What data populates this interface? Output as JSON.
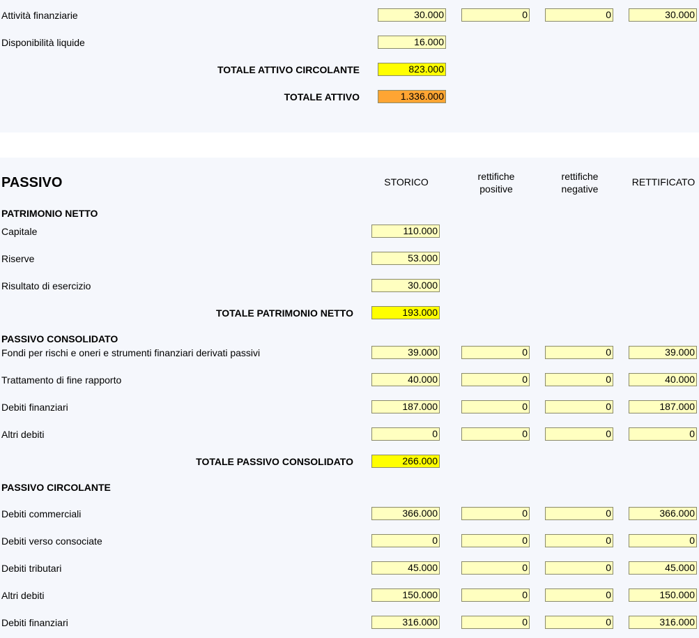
{
  "attivo_tail": {
    "rows": [
      {
        "label": "Attività finanziarie",
        "values": [
          "30.000",
          "0",
          "0",
          "30.000"
        ]
      },
      {
        "label": "Disponibilità liquide",
        "values": [
          "16.000"
        ]
      }
    ],
    "total_circolante": {
      "label": "TOTALE ATTIVO CIRCOLANTE",
      "value": "823.000"
    },
    "total_attivo": {
      "label": "TOTALE ATTIVO",
      "value": "1.336.000"
    }
  },
  "passivo": {
    "title": "PASSIVO",
    "columns": [
      "STORICO",
      "rettifiche\npositive",
      "rettifiche\nnegative",
      "RETTIFICATO"
    ],
    "patrimonio": {
      "heading": "PATRIMONIO NETTO",
      "rows": [
        {
          "label": "Capitale",
          "value": "110.000"
        },
        {
          "label": "Riserve",
          "value": "53.000"
        },
        {
          "label": "Risultato di esercizio",
          "value": "30.000"
        }
      ],
      "total": {
        "label": "TOTALE PATRIMONIO NETTO",
        "value": "193.000"
      }
    },
    "consolidato": {
      "heading": "PASSIVO CONSOLIDATO",
      "rows": [
        {
          "label": "Fondi per rischi e oneri e strumenti finanziari derivati passivi",
          "values": [
            "39.000",
            "0",
            "0",
            "39.000"
          ]
        },
        {
          "label": "Trattamento di fine rapporto",
          "values": [
            "40.000",
            "0",
            "0",
            "40.000"
          ]
        },
        {
          "label": "Debiti finanziari",
          "values": [
            "187.000",
            "0",
            "0",
            "187.000"
          ]
        },
        {
          "label": "Altri debiti",
          "values": [
            "0",
            "0",
            "0",
            "0"
          ]
        }
      ],
      "total": {
        "label": "TOTALE PASSIVO CONSOLIDATO",
        "value": "266.000"
      }
    },
    "circolante": {
      "heading": "PASSIVO CIRCOLANTE",
      "rows": [
        {
          "label": "Debiti commerciali",
          "values": [
            "366.000",
            "0",
            "0",
            "366.000"
          ]
        },
        {
          "label": "Debiti verso consociate",
          "values": [
            "0",
            "0",
            "0",
            "0"
          ]
        },
        {
          "label": "Debiti tributari",
          "values": [
            "45.000",
            "0",
            "0",
            "45.000"
          ]
        },
        {
          "label": "Altri debiti",
          "values": [
            "150.000",
            "0",
            "0",
            "150.000"
          ]
        },
        {
          "label": "Debiti finanziari",
          "values": [
            "316.000",
            "0",
            "0",
            "316.000"
          ]
        }
      ]
    }
  }
}
